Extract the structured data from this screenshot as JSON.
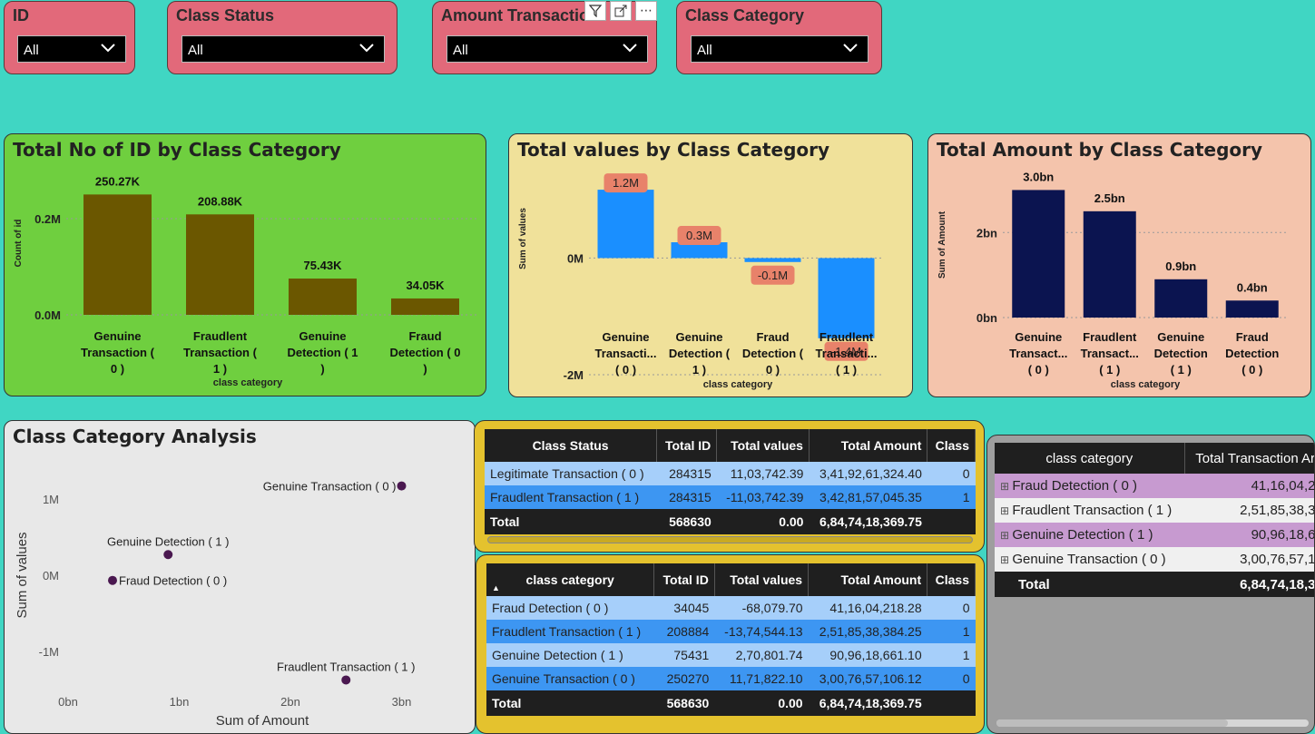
{
  "slicers": [
    {
      "title": "ID",
      "value": "All"
    },
    {
      "title": "Class Status",
      "value": "All"
    },
    {
      "title": "Amount Transactio",
      "value": "All"
    },
    {
      "title": "Class Category",
      "value": "All"
    }
  ],
  "visual_toolbar": {
    "more": "⋯"
  },
  "chart1": {
    "title": "Total No of ID by Class Category",
    "chart_data": {
      "type": "bar",
      "categories": [
        "Genuine Transaction ( 0 )",
        "Fraudlent Transaction ( 1 )",
        "Genuine Detection ( 1 )",
        "Fraud Detection ( 0 )"
      ],
      "values": [
        250270,
        208884,
        75431,
        34045
      ],
      "data_labels": [
        "250.27K",
        "208.88K",
        "75.43K",
        "34.05K"
      ],
      "ylabel": "Count of id",
      "xlabel": "class category",
      "yticks": [
        "0.2M",
        "0.0M"
      ],
      "ylim": [
        0,
        300000
      ],
      "color": "#6b5700"
    },
    "cat_lines": [
      [
        "Genuine",
        "Transaction (",
        "0 )"
      ],
      [
        "Fraudlent",
        "Transaction (",
        "1 )"
      ],
      [
        "Genuine",
        "Detection ( 1",
        ")"
      ],
      [
        "Fraud",
        "Detection ( 0",
        ")"
      ]
    ]
  },
  "chart2": {
    "title": "Total values by Class Category",
    "chart_data": {
      "type": "bar",
      "categories": [
        "Genuine Transaction ( 0 )",
        "Genuine Detection ( 1 )",
        "Fraud Detection ( 0 )",
        "Fraudlent Transaction ( 1 )"
      ],
      "values": [
        1171822.1,
        270801.74,
        -68079.7,
        -1374544.13
      ],
      "data_labels": [
        "1.2M",
        "0.3M",
        "-0.1M",
        "-1.4M"
      ],
      "ylabel": "Sum of values",
      "xlabel": "class category",
      "yticks": [
        "0M",
        "-2M"
      ],
      "ylim": [
        -2000000,
        1500000
      ],
      "color": "#1a8fff"
    },
    "cat_lines": [
      [
        "Genuine",
        "Transacti...",
        "( 0 )"
      ],
      [
        "Genuine",
        "Detection (",
        "1 )"
      ],
      [
        "Fraud",
        "Detection (",
        "0 )"
      ],
      [
        "Fraudlent",
        "Transacti...",
        "( 1 )"
      ]
    ]
  },
  "chart3": {
    "title": "Total Amount by Class Category",
    "chart_data": {
      "type": "bar",
      "categories": [
        "Genuine Transaction ( 0 )",
        "Fraudlent Transaction ( 1 )",
        "Genuine Detection ( 1 )",
        "Fraud Detection ( 0 )"
      ],
      "values": [
        3.0,
        2.5,
        0.9,
        0.4
      ],
      "data_labels": [
        "3.0bn",
        "2.5bn",
        "0.9bn",
        "0.4bn"
      ],
      "ylabel": "Sum of Amount",
      "xlabel": "class category",
      "yticks": [
        "2bn",
        "0bn"
      ],
      "ylim": [
        0,
        3.5
      ],
      "color": "#0b1450"
    },
    "cat_lines": [
      [
        "Genuine",
        "Transact...",
        "( 0 )"
      ],
      [
        "Fraudlent",
        "Transact...",
        "( 1 )"
      ],
      [
        "Genuine",
        "Detection",
        "( 1 )"
      ],
      [
        "Fraud",
        "Detection",
        "( 0 )"
      ]
    ]
  },
  "scatter": {
    "title": "Class Category Analysis",
    "chart_data": {
      "type": "scatter",
      "points": [
        {
          "label": "Genuine Transaction ( 0 )",
          "x": 3.0,
          "y": 1171822.1
        },
        {
          "label": "Genuine Detection ( 1 )",
          "x": 0.9,
          "y": 270801.74
        },
        {
          "label": "Fraud Detection ( 0 )",
          "x": 0.4,
          "y": -68079.7
        },
        {
          "label": "Fraudlent Transaction ( 1 )",
          "x": 2.5,
          "y": -1374544.13
        }
      ],
      "xlabel": "Sum of Amount",
      "ylabel": "Sum of values",
      "xticks": [
        "0bn",
        "1bn",
        "2bn",
        "3bn"
      ],
      "yticks": [
        "1M",
        "0M",
        "-1M"
      ],
      "color": "#4a1850"
    }
  },
  "table1": {
    "headers": [
      "Class Status",
      "Total ID",
      "Total values",
      "Total Amount",
      "Class"
    ],
    "rows": [
      [
        "Legitimate Transaction ( 0 )",
        "284315",
        "11,03,742.39",
        "3,41,92,61,324.40",
        "0"
      ],
      [
        "Fraudlent Transaction ( 1 )",
        "284315",
        "-11,03,742.39",
        "3,42,81,57,045.35",
        "1"
      ]
    ],
    "total": [
      "Total",
      "568630",
      "0.00",
      "6,84,74,18,369.75",
      ""
    ]
  },
  "table2": {
    "headers": [
      "class category",
      "Total ID",
      "Total values",
      "Total Amount",
      "Class"
    ],
    "sort_icon": "▲",
    "rows": [
      [
        "Fraud Detection ( 0 )",
        "34045",
        "-68,079.70",
        "41,16,04,218.28",
        "0"
      ],
      [
        "Fraudlent Transaction ( 1 )",
        "208884",
        "-13,74,544.13",
        "2,51,85,38,384.25",
        "1"
      ],
      [
        "Genuine Detection ( 1 )",
        "75431",
        "2,70,801.74",
        "90,96,18,661.10",
        "1"
      ],
      [
        "Genuine Transaction ( 0 )",
        "250270",
        "11,71,822.10",
        "3,00,76,57,106.12",
        "0"
      ]
    ],
    "total": [
      "Total",
      "568630",
      "0.00",
      "6,84,74,18,369.75",
      ""
    ]
  },
  "matrix": {
    "headers": [
      "class category",
      "Total Transaction Ar"
    ],
    "expand_icon": "⊞",
    "rows": [
      [
        "Fraud Detection ( 0 )",
        "41,16,04,2"
      ],
      [
        "Fraudlent Transaction ( 1 )",
        "2,51,85,38,3"
      ],
      [
        "Genuine Detection ( 1 )",
        "90,96,18,6"
      ],
      [
        "Genuine Transaction ( 0 )",
        "3,00,76,57,1"
      ]
    ],
    "total": [
      "Total",
      "6,84,74,18,3"
    ]
  }
}
